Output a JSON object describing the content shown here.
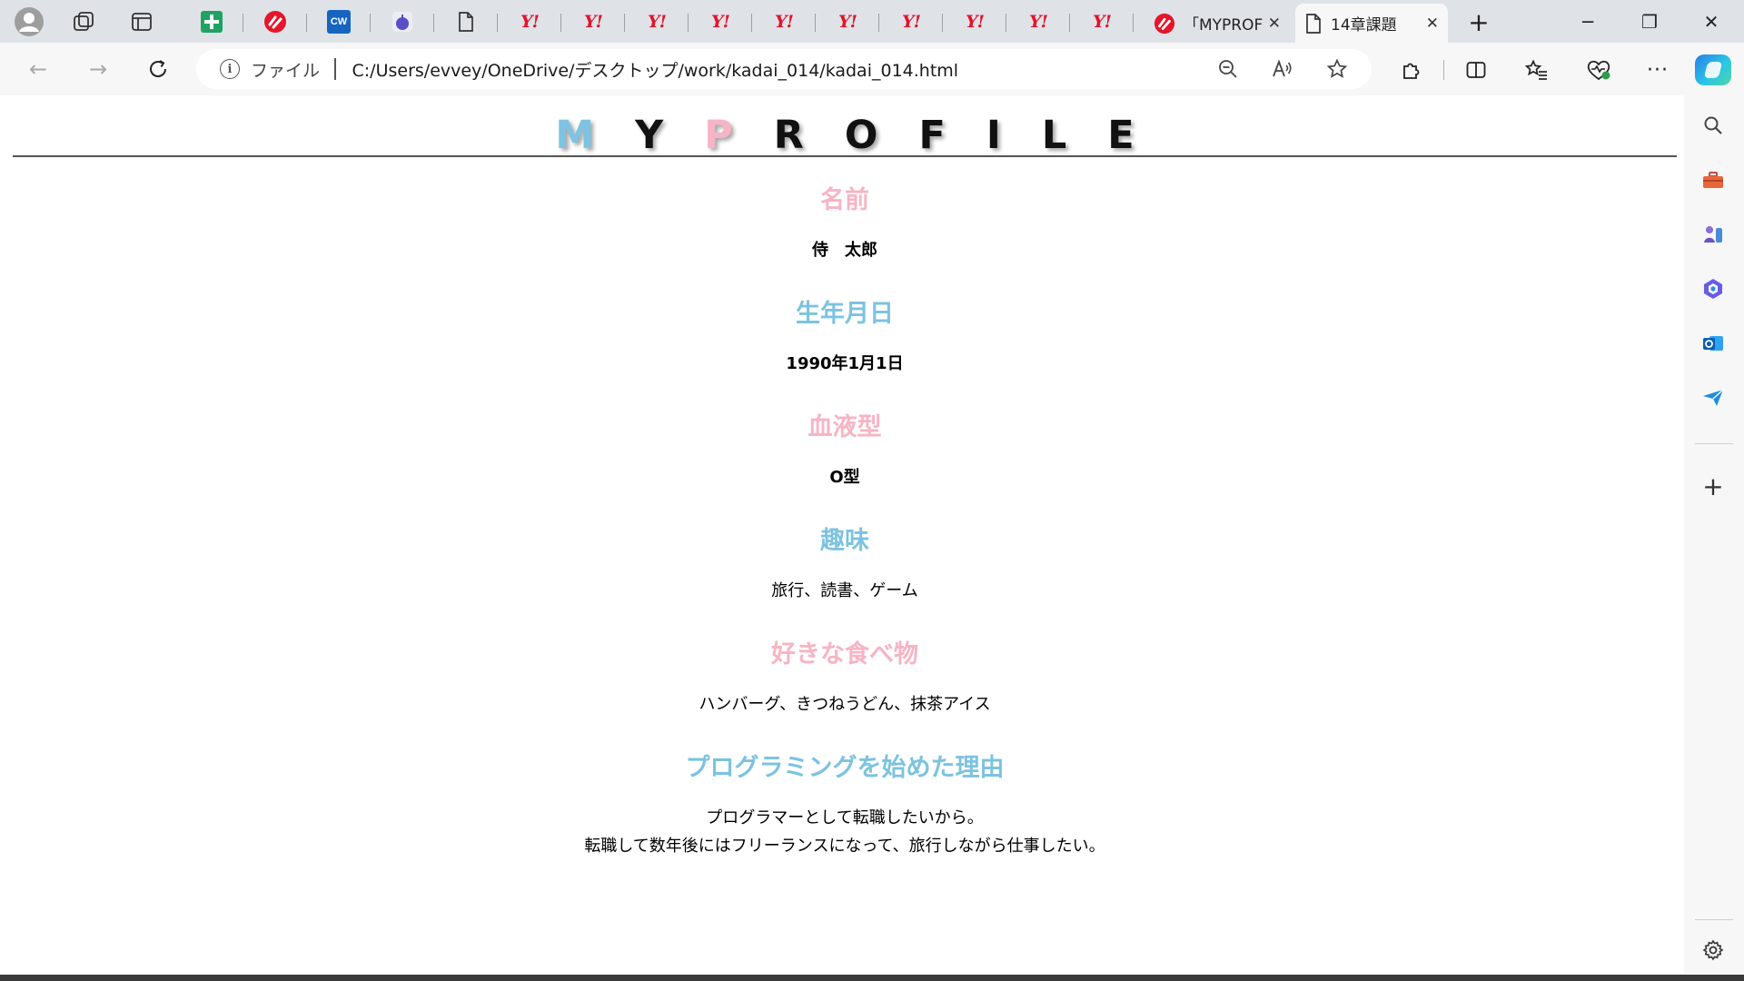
{
  "browser": {
    "pinned_tabs": [
      {
        "name": "profile-icon"
      },
      {
        "name": "workspaces-icon"
      },
      {
        "name": "tab-actions-icon"
      }
    ],
    "tabs": [
      {
        "icon": "sheets-plus-icon"
      },
      {
        "icon": "samurai-logo-icon"
      },
      {
        "icon": "crowdworks-icon",
        "label": "CW"
      },
      {
        "icon": "apple-icon"
      },
      {
        "icon": "blank-page-icon"
      },
      {
        "icon": "yahoo-icon",
        "label": "Y!"
      },
      {
        "icon": "yahoo-icon",
        "label": "Y!"
      },
      {
        "icon": "yahoo-icon",
        "label": "Y!"
      },
      {
        "icon": "yahoo-icon",
        "label": "Y!"
      },
      {
        "icon": "yahoo-icon",
        "label": "Y!"
      },
      {
        "icon": "yahoo-icon",
        "label": "Y!"
      },
      {
        "icon": "yahoo-icon",
        "label": "Y!"
      },
      {
        "icon": "yahoo-icon",
        "label": "Y!"
      },
      {
        "icon": "yahoo-icon",
        "label": "Y!"
      },
      {
        "icon": "yahoo-icon",
        "label": "Y!"
      }
    ],
    "wide_tab": {
      "title": "「MYPROFILE」",
      "close": "✕"
    },
    "active_tab": {
      "title": "14章課題",
      "close": "✕"
    },
    "new_tab": "+",
    "window": {
      "minimize": "─",
      "restore": "❐",
      "close": "✕"
    },
    "address": {
      "file_label": "ファイル",
      "url": "C:/Users/evvey/OneDrive/デスクトップ/work/kadai_014/kadai_014.html"
    }
  },
  "page": {
    "brand": [
      {
        "ch": "M",
        "color": "blue"
      },
      {
        "ch": "Y",
        "color": "dark"
      },
      {
        "ch": "P",
        "color": "pink"
      },
      {
        "ch": "R",
        "color": "dark"
      },
      {
        "ch": "O",
        "color": "dark"
      },
      {
        "ch": "F",
        "color": "dark"
      },
      {
        "ch": "I",
        "color": "dark"
      },
      {
        "ch": "L",
        "color": "dark"
      },
      {
        "ch": "E",
        "color": "dark"
      }
    ],
    "sections": [
      {
        "title": "名前",
        "title_color": "pink",
        "value": "侍　太郎",
        "bold": true
      },
      {
        "title": "生年月日",
        "title_color": "blue",
        "value": "1990年1月1日",
        "bold": true
      },
      {
        "title": "血液型",
        "title_color": "pink",
        "value": "O型",
        "bold": true
      },
      {
        "title": "趣味",
        "title_color": "blue",
        "value": "旅行、読書、ゲーム",
        "bold": false
      },
      {
        "title": "好きな食べ物",
        "title_color": "pink",
        "value": "ハンバーグ、きつねうどん、抹茶アイス",
        "bold": false
      },
      {
        "title": "プログラミングを始めた理由",
        "title_color": "blue",
        "lines": [
          "プログラマーとして転職したいから。",
          "転職して数年後にはフリーランスになって、旅行しながら仕事したい。"
        ],
        "bold": false
      }
    ],
    "colors": {
      "pink": "#f7b4c4",
      "blue": "#7cc3e0",
      "dark": "#111111"
    }
  }
}
